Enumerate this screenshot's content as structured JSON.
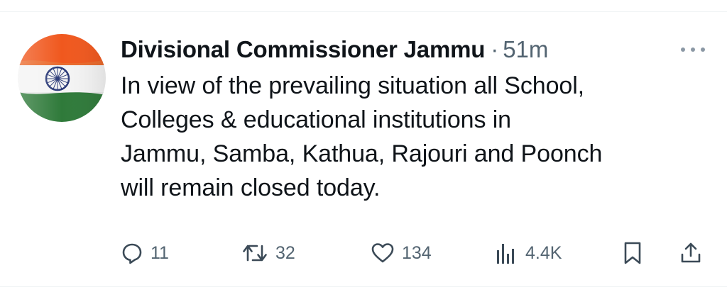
{
  "tweet": {
    "display_name": "Divisional Commissioner Jammu",
    "separator": "·",
    "timestamp": "51m",
    "text": "In view of the prevailing situation all School,\nColleges & educational institutions in\nJammu, Samba, Kathua, Rajouri and Poonch\nwill remain closed today.",
    "avatar_icon": "indian-flag-icon",
    "more_icon": "more-dots-icon"
  },
  "actions": {
    "reply": {
      "icon": "reply-icon",
      "count": "11"
    },
    "retweet": {
      "icon": "retweet-icon",
      "count": "32"
    },
    "like": {
      "icon": "heart-icon",
      "count": "134"
    },
    "views": {
      "icon": "views-chart-icon",
      "count": "4.4K"
    },
    "bookmark": {
      "icon": "bookmark-icon"
    },
    "share": {
      "icon": "share-icon"
    }
  },
  "colors": {
    "text_primary": "#0f1419",
    "text_secondary": "#536471",
    "divider": "#eff3f4",
    "flag_saffron": "#f0581e",
    "flag_white": "#f4f4f4",
    "flag_green": "#2f7a3a",
    "chakra_navy": "#2b3a78"
  }
}
